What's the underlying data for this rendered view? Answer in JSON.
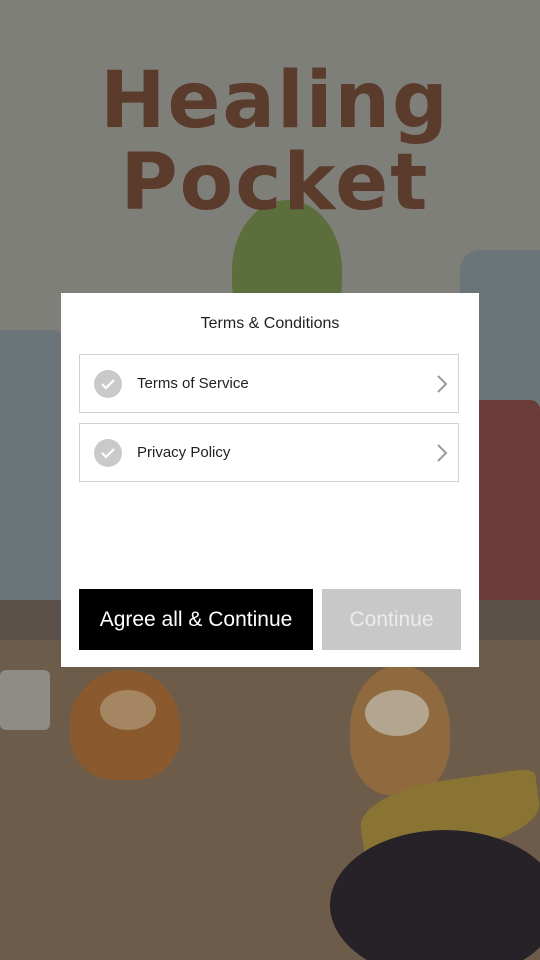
{
  "background": {
    "game_title": "Healing Pocket"
  },
  "dialog": {
    "title": "Terms & Conditions",
    "items": [
      {
        "label": "Terms of Service",
        "checked": false,
        "icon": "check-icon"
      },
      {
        "label": "Privacy Policy",
        "checked": false,
        "icon": "check-icon"
      }
    ],
    "buttons": {
      "agree_all": "Agree all & Continue",
      "continue": "Continue"
    }
  },
  "colors": {
    "agree_button": "#000000",
    "continue_button_disabled": "#c8c8c8",
    "check_circle": "#c9c9c9"
  }
}
